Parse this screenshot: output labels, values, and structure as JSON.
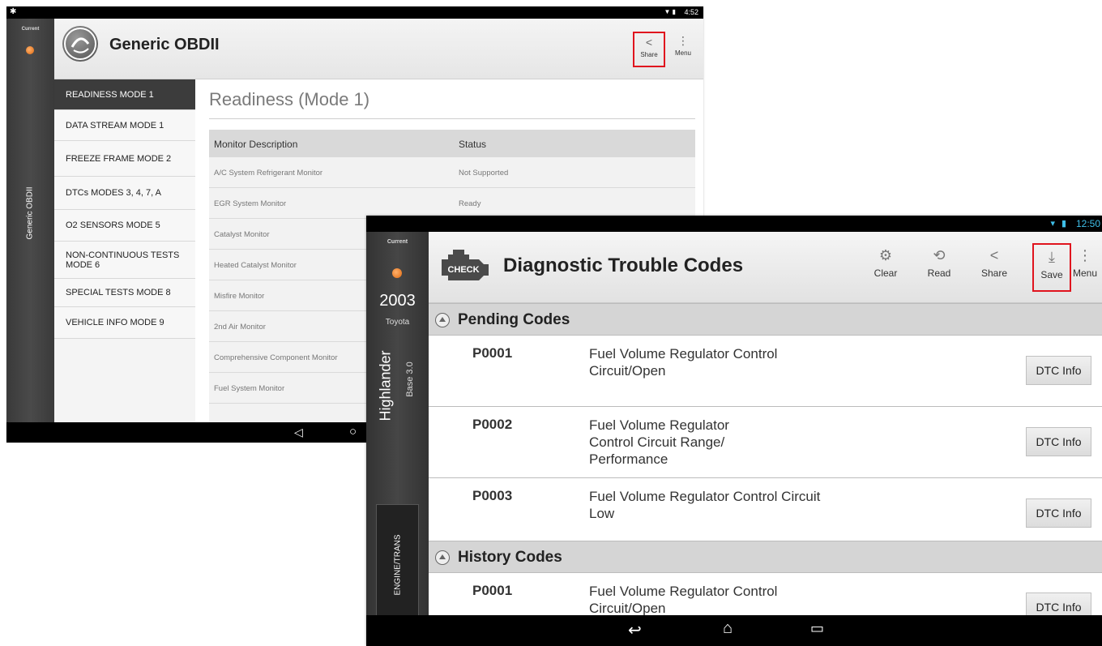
{
  "window1": {
    "status_time": "4:52",
    "rail": {
      "current_label": "Current",
      "vertical_label": "Generic OBDII"
    },
    "app_title": "Generic OBDII",
    "toolbar": {
      "share_label": "Share",
      "menu_label": "Menu"
    },
    "nav_items": [
      {
        "label": "READINESS MODE 1"
      },
      {
        "label": "DATA STREAM MODE 1"
      },
      {
        "label": "FREEZE FRAME MODE 2"
      },
      {
        "label": "DTCs MODES 3, 4, 7, A"
      },
      {
        "label": "O2 SENSORS MODE 5"
      },
      {
        "label": "NON-CONTINUOUS TESTS MODE 6"
      },
      {
        "label": "SPECIAL TESTS MODE 8"
      },
      {
        "label": "VEHICLE INFO MODE 9"
      }
    ],
    "main_title": "Readiness (Mode 1)",
    "table": {
      "headers": {
        "description": "Monitor Description",
        "status": "Status"
      },
      "rows": [
        {
          "description": "A/C System Refrigerant Monitor",
          "status": "Not Supported"
        },
        {
          "description": "EGR System Monitor",
          "status": "Ready"
        },
        {
          "description": "Catalyst Monitor",
          "status": ""
        },
        {
          "description": "Heated Catalyst Monitor",
          "status": ""
        },
        {
          "description": "Misfire Monitor",
          "status": ""
        },
        {
          "description": "2nd Air Monitor",
          "status": ""
        },
        {
          "description": "Comprehensive Component Monitor",
          "status": ""
        },
        {
          "description": "Fuel System Monitor",
          "status": ""
        }
      ]
    }
  },
  "window2": {
    "status_time": "12:50",
    "rail": {
      "current_label": "Current",
      "year": "2003",
      "make": "Toyota",
      "model": "Highlander",
      "trim": "Base 3.0",
      "system_label": "ENGINE/TRANS"
    },
    "engine_badge": "CHECK",
    "app_title": "Diagnostic Trouble Codes",
    "toolbar": {
      "clear_label": "Clear",
      "read_label": "Read",
      "share_label": "Share",
      "save_label": "Save",
      "menu_label": "Menu"
    },
    "pending_title": "Pending Codes",
    "pending_codes": [
      {
        "code": "P0001",
        "description": "Fuel Volume Regulator Control Circuit/Open",
        "button": "DTC Info"
      },
      {
        "code": "P0002",
        "description": "Fuel Volume Regulator Control Circuit Range/ Performance",
        "button": "DTC Info"
      },
      {
        "code": "P0003",
        "description": "Fuel Volume Regulator Control Circuit Low",
        "button": "DTC Info"
      }
    ],
    "history_title": "History Codes",
    "history_codes": [
      {
        "code": "P0001",
        "description": "Fuel Volume Regulator Control Circuit/Open",
        "button": "DTC Info"
      }
    ]
  }
}
